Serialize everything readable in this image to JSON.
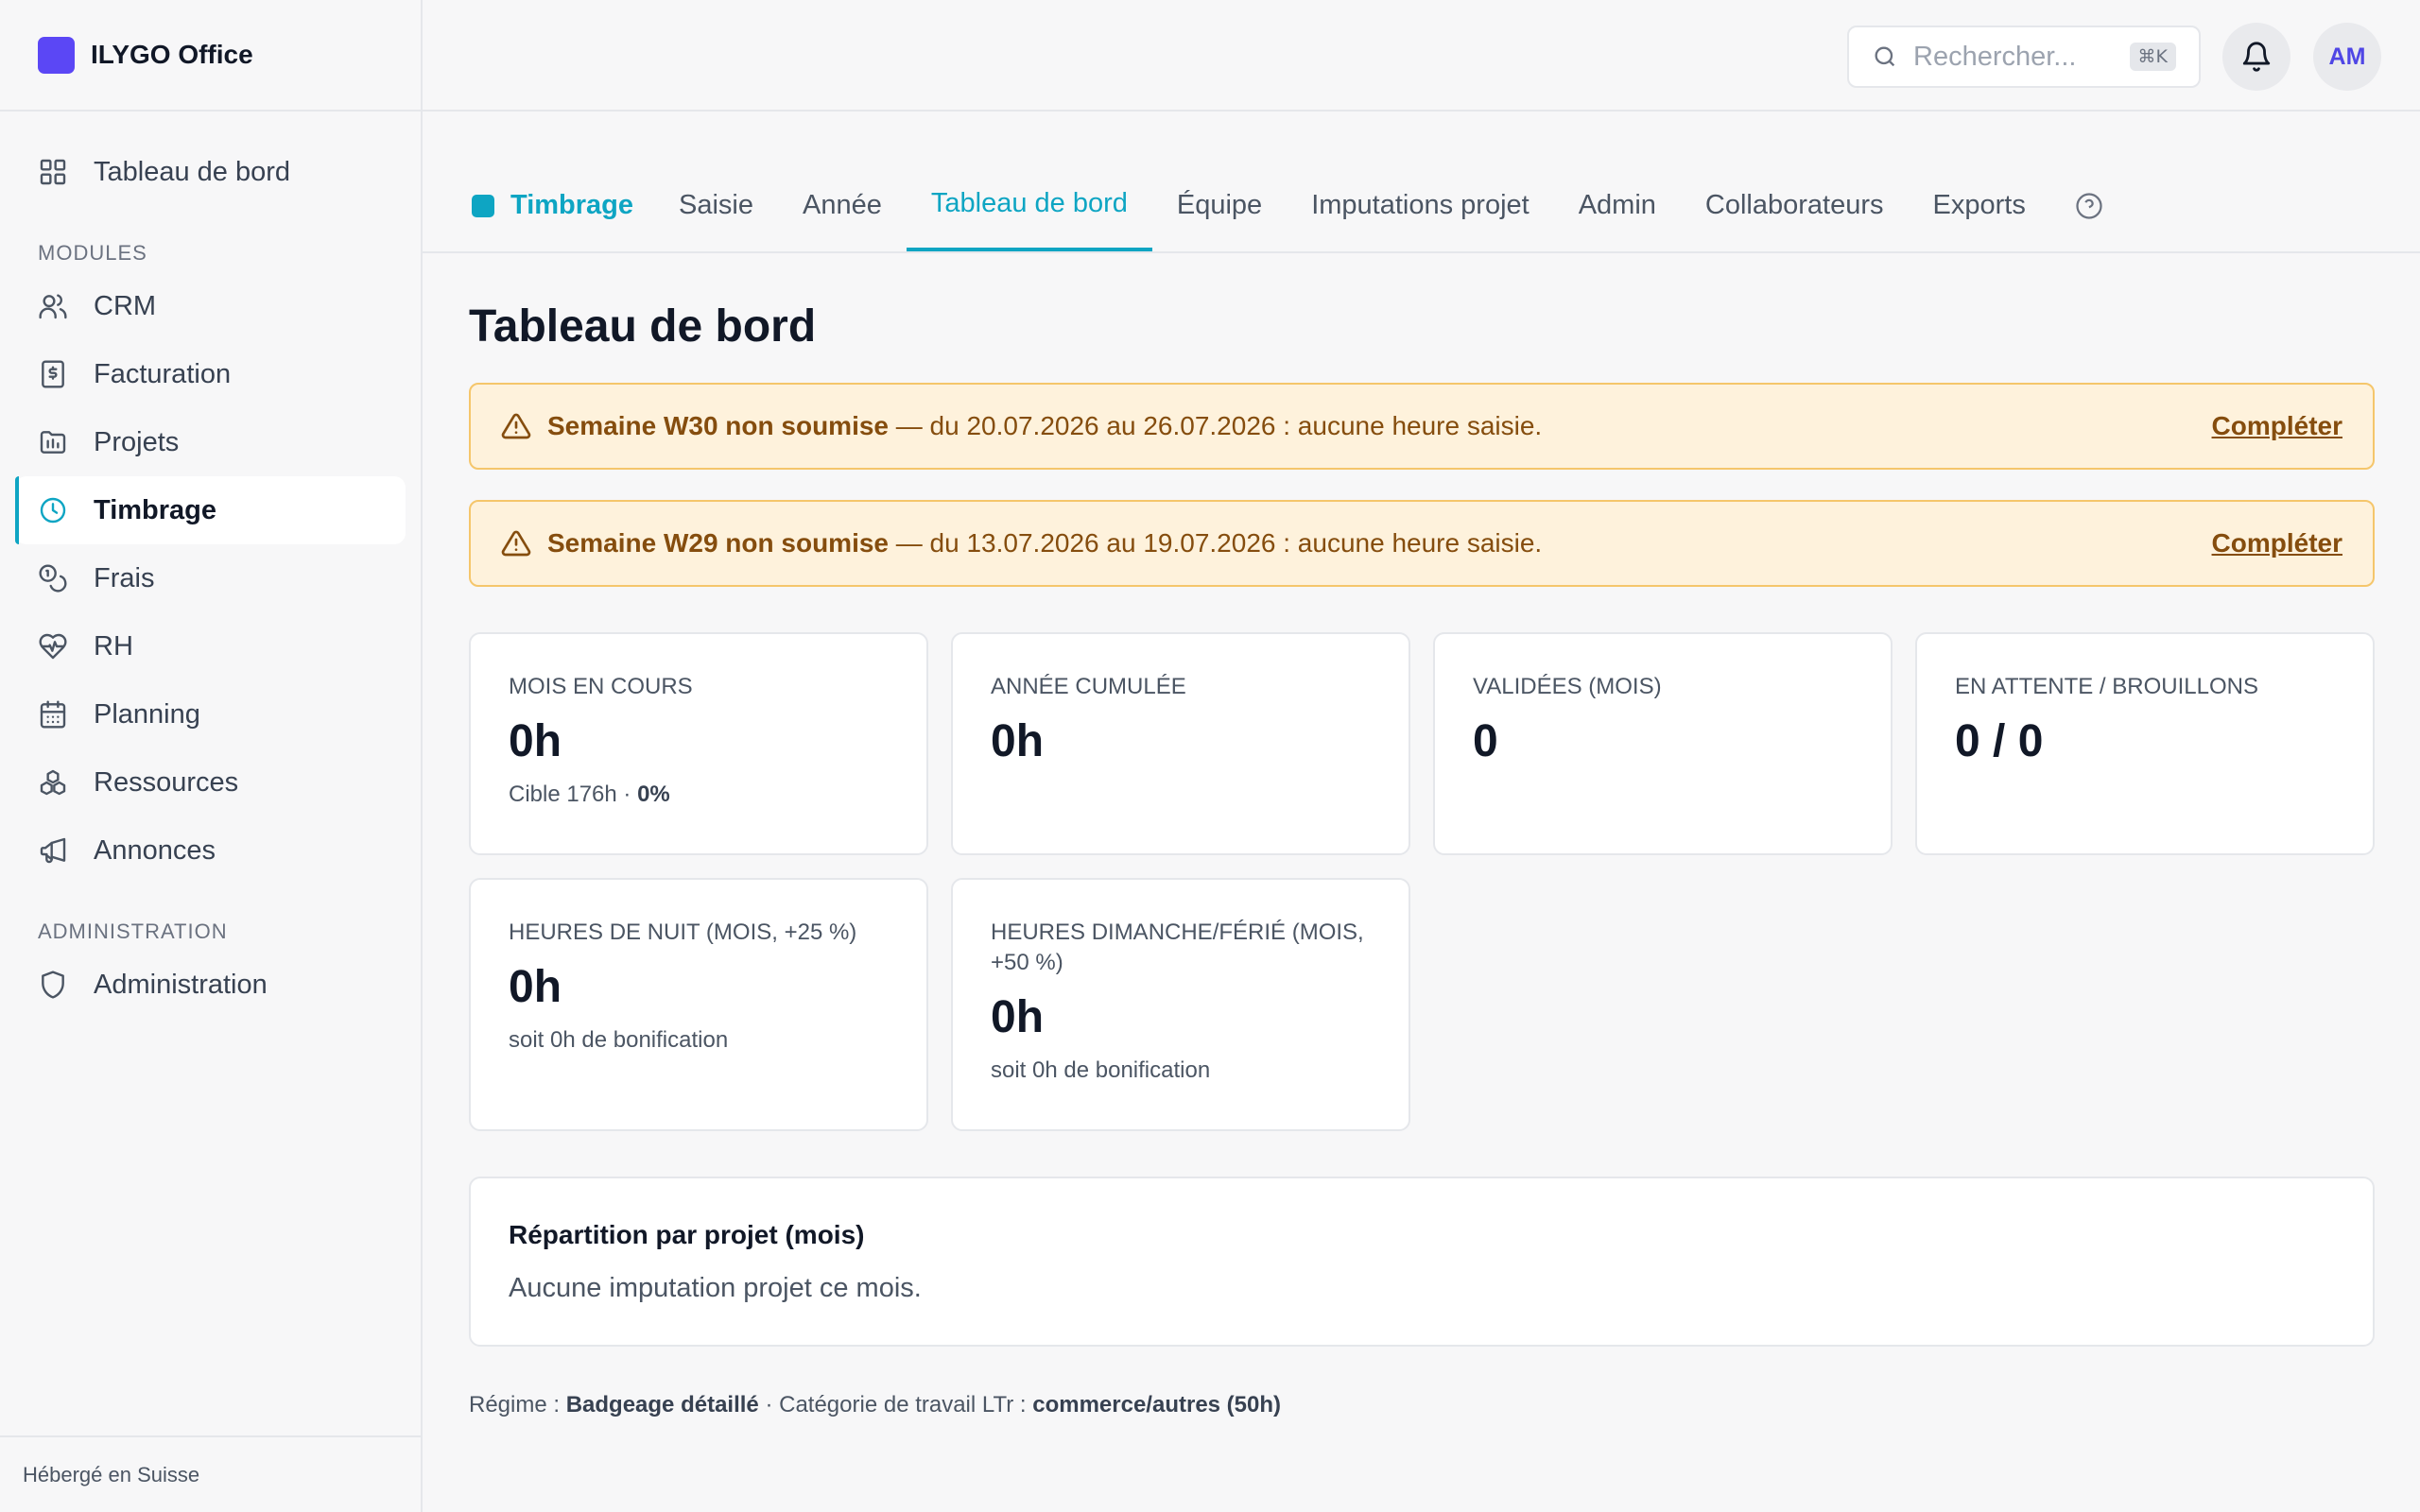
{
  "app": {
    "name": "ILYGO Office"
  },
  "sidebar": {
    "dashboard": "Tableau de bord",
    "modules_title": "MODULES",
    "modules": [
      {
        "label": "CRM",
        "icon": "users-icon"
      },
      {
        "label": "Facturation",
        "icon": "invoice-icon"
      },
      {
        "label": "Projets",
        "icon": "folder-icon"
      },
      {
        "label": "Timbrage",
        "icon": "clock-icon"
      },
      {
        "label": "Frais",
        "icon": "coins-icon"
      },
      {
        "label": "RH",
        "icon": "heart-pulse-icon"
      },
      {
        "label": "Planning",
        "icon": "calendar-icon"
      },
      {
        "label": "Ressources",
        "icon": "boxes-icon"
      },
      {
        "label": "Annonces",
        "icon": "megaphone-icon"
      }
    ],
    "admin_title": "ADMINISTRATION",
    "admin": "Administration",
    "footer": "Hébergé en Suisse"
  },
  "header": {
    "search_placeholder": "Rechercher...",
    "search_shortcut": "⌘K",
    "avatar": "AM"
  },
  "tabs": {
    "module": "Timbrage",
    "items": [
      "Saisie",
      "Année",
      "Tableau de bord",
      "Équipe",
      "Imputations projet",
      "Admin",
      "Collaborateurs",
      "Exports"
    ],
    "active": "Tableau de bord"
  },
  "page": {
    "title": "Tableau de bord"
  },
  "alerts": [
    {
      "bold": "Semaine W30 non soumise",
      "text": " — du 20.07.2026 au 26.07.2026 : aucune heure saisie.",
      "action": "Compléter"
    },
    {
      "bold": "Semaine W29 non soumise",
      "text": " — du 13.07.2026 au 19.07.2026 : aucune heure saisie.",
      "action": "Compléter"
    }
  ],
  "cards": {
    "month": {
      "label": "MOIS EN COURS",
      "value": "0h",
      "sub_prefix": "Cible 176h · ",
      "sub_bold": "0%"
    },
    "year": {
      "label": "ANNÉE CUMULÉE",
      "value": "0h"
    },
    "validated": {
      "label": "VALIDÉES (MOIS)",
      "value": "0"
    },
    "pending": {
      "label": "EN ATTENTE / BROUILLONS",
      "value": "0 / 0"
    },
    "night": {
      "label": "HEURES DE NUIT (MOIS, +25 %)",
      "value": "0h",
      "sub": "soit 0h de bonification"
    },
    "sunday": {
      "label": "HEURES DIMANCHE/FÉRIÉ (MOIS, +50 %)",
      "value": "0h",
      "sub": "soit 0h de bonification"
    }
  },
  "projects_panel": {
    "title": "Répartition par projet (mois)",
    "empty": "Aucune imputation projet ce mois."
  },
  "footer": {
    "regime_label": "Régime : ",
    "regime_value": "Badgeage détaillé",
    "category_label": " · Catégorie de travail LTr : ",
    "category_value": "commerce/autres (50h)"
  },
  "colors": {
    "accent": "#0ea5c3",
    "brand": "#5b47f5",
    "warning_bg": "#fef2dc",
    "warning_text": "#854d0e"
  }
}
